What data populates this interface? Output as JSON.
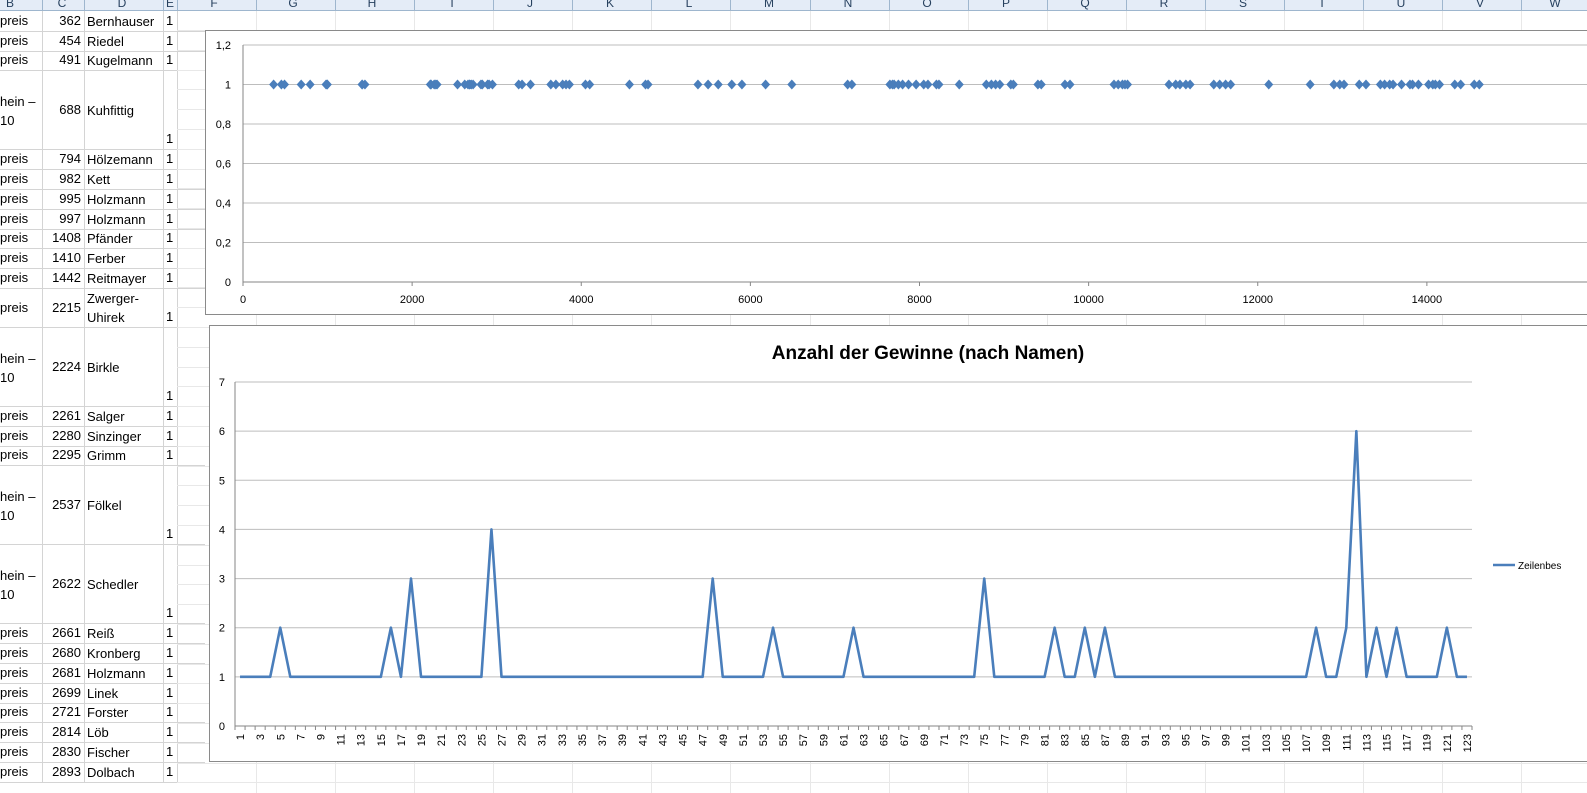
{
  "spreadsheet": {
    "columns": [
      "B",
      "C",
      "D",
      "E",
      "F",
      "G",
      "H",
      "I",
      "J",
      "K",
      "L",
      "M",
      "N",
      "O",
      "P",
      "Q",
      "R",
      "S",
      "T",
      "U",
      "V",
      "W"
    ],
    "rows": [
      {
        "a": "preis",
        "c": "362",
        "d": "Bernhauser",
        "e": "1"
      },
      {
        "a": "preis",
        "c": "454",
        "d": "Riedel",
        "e": "1"
      },
      {
        "a": "preis",
        "c": "491",
        "d": "Kugelmann",
        "e": "1"
      },
      {
        "a": "hein –\n10",
        "c": "688",
        "d": "Kuhfittig",
        "e": "1"
      },
      {
        "a": "preis",
        "c": "794",
        "d": "Hölzemann",
        "e": "1"
      },
      {
        "a": "preis",
        "c": "982",
        "d": "Kett",
        "e": "1"
      },
      {
        "a": "preis",
        "c": "995",
        "d": "Holzmann",
        "e": "1"
      },
      {
        "a": "preis",
        "c": "997",
        "d": "Holzmann",
        "e": "1"
      },
      {
        "a": "preis",
        "c": "1408",
        "d": "Pfänder",
        "e": "1"
      },
      {
        "a": "preis",
        "c": "1410",
        "d": "Ferber",
        "e": "1"
      },
      {
        "a": "preis",
        "c": "1442",
        "d": "Reitmayer",
        "e": "1"
      },
      {
        "a": "preis",
        "c": "2215",
        "d": "Zwerger-\nUhirek",
        "e": "1"
      },
      {
        "a": "hein –\n10",
        "c": "2224",
        "d": "Birkle",
        "e": "1"
      },
      {
        "a": "preis",
        "c": "2261",
        "d": "Salger",
        "e": "1"
      },
      {
        "a": "preis",
        "c": "2280",
        "d": "Sinzinger",
        "e": "1"
      },
      {
        "a": "preis",
        "c": "2295",
        "d": "Grimm",
        "e": "1"
      },
      {
        "a": "hein –\n10",
        "c": "2537",
        "d": "Fölkel",
        "e": "1"
      },
      {
        "a": "hein –\n10",
        "c": "2622",
        "d": "Schedler",
        "e": "1"
      },
      {
        "a": "preis",
        "c": "2661",
        "d": "Reiß",
        "e": "1"
      },
      {
        "a": "preis",
        "c": "2680",
        "d": "Kronberg",
        "e": "1"
      },
      {
        "a": "preis",
        "c": "2681",
        "d": "Holzmann",
        "e": "1"
      },
      {
        "a": "preis",
        "c": "2699",
        "d": "Linek",
        "e": "1"
      },
      {
        "a": "preis",
        "c": "2721",
        "d": "Forster",
        "e": "1"
      },
      {
        "a": "preis",
        "c": "2814",
        "d": "Löb",
        "e": "1"
      },
      {
        "a": "preis",
        "c": "2830",
        "d": "Fischer",
        "e": "1"
      },
      {
        "a": "preis",
        "c": "2893",
        "d": "Dolbach",
        "e": "1"
      }
    ]
  },
  "chart_data": [
    {
      "type": "scatter",
      "title": "",
      "xlim": [
        0,
        16000
      ],
      "ylim": [
        0,
        1.2
      ],
      "xticks": [
        "0",
        "2000",
        "4000",
        "6000",
        "8000",
        "10000",
        "12000",
        "14000"
      ],
      "yticks": [
        "0",
        "0,2",
        "0,4",
        "0,6",
        "0,8",
        "1",
        "1,2"
      ],
      "grid": true,
      "color": "#4a7ebb",
      "x": [
        362,
        454,
        491,
        688,
        794,
        982,
        995,
        997,
        1408,
        1410,
        1442,
        2215,
        2224,
        2261,
        2280,
        2295,
        2537,
        2622,
        2661,
        2680,
        2681,
        2699,
        2721,
        2814,
        2830,
        2893,
        2910,
        2950,
        3260,
        3300,
        3400,
        3640,
        3700,
        3780,
        3820,
        3860,
        4050,
        4100,
        4570,
        4760,
        4790,
        5380,
        5500,
        5620,
        5780,
        5900,
        6180,
        6490,
        7150,
        7200,
        7650,
        7680,
        7700,
        7750,
        7800,
        7870,
        7960,
        8050,
        8100,
        8200,
        8230,
        8470,
        8790,
        8850,
        8900,
        8950,
        9080,
        9110,
        9400,
        9440,
        9720,
        9780,
        10300,
        10350,
        10400,
        10430,
        10460,
        10950,
        11030,
        11080,
        11150,
        11200,
        11480,
        11550,
        11620,
        11680,
        12130,
        12620,
        12900,
        12970,
        13020,
        13200,
        13280,
        13450,
        13500,
        13560,
        13600,
        13700,
        13800,
        13830,
        13900,
        14020,
        14070,
        14100,
        14150,
        14330,
        14400,
        14560,
        14620
      ],
      "y": [
        1,
        1,
        1,
        1,
        1,
        1,
        1,
        1,
        1,
        1,
        1,
        1,
        1,
        1,
        1,
        1,
        1,
        1,
        1,
        1,
        1,
        1,
        1,
        1,
        1,
        1,
        1,
        1,
        1,
        1,
        1,
        1,
        1,
        1,
        1,
        1,
        1,
        1,
        1,
        1,
        1,
        1,
        1,
        1,
        1,
        1,
        1,
        1,
        1,
        1,
        1,
        1,
        1,
        1,
        1,
        1,
        1,
        1,
        1,
        1,
        1,
        1,
        1,
        1,
        1,
        1,
        1,
        1,
        1,
        1,
        1,
        1,
        1,
        1,
        1,
        1,
        1,
        1,
        1,
        1,
        1,
        1,
        1,
        1,
        1,
        1,
        1,
        1,
        1,
        1,
        1,
        1,
        1,
        1,
        1,
        1,
        1,
        1,
        1,
        1,
        1,
        1,
        1,
        1,
        1,
        1,
        1,
        1,
        1
      ]
    },
    {
      "type": "line",
      "title": "Anzahl der Gewinne (nach Namen)",
      "ylim": [
        0,
        7
      ],
      "yticks": [
        "0",
        "1",
        "2",
        "3",
        "4",
        "5",
        "6",
        "7"
      ],
      "xcount": 123,
      "xlabel_step": 2,
      "grid": true,
      "color": "#4a7ebb",
      "legend_position": "right",
      "series": [
        {
          "name": "Zeilenbes",
          "values": [
            1,
            1,
            1,
            1,
            2,
            1,
            1,
            1,
            1,
            1,
            1,
            1,
            1,
            1,
            1,
            2,
            1,
            3,
            1,
            1,
            1,
            1,
            1,
            1,
            1,
            4,
            1,
            1,
            1,
            1,
            1,
            1,
            1,
            1,
            1,
            1,
            1,
            1,
            1,
            1,
            1,
            1,
            1,
            1,
            1,
            1,
            1,
            3,
            1,
            1,
            1,
            1,
            1,
            2,
            1,
            1,
            1,
            1,
            1,
            1,
            1,
            2,
            1,
            1,
            1,
            1,
            1,
            1,
            1,
            1,
            1,
            1,
            1,
            1,
            3,
            1,
            1,
            1,
            1,
            1,
            1,
            2,
            1,
            1,
            2,
            1,
            2,
            1,
            1,
            1,
            1,
            1,
            1,
            1,
            1,
            1,
            1,
            1,
            1,
            1,
            1,
            1,
            1,
            1,
            1,
            1,
            1,
            2,
            1,
            1,
            2,
            6,
            1,
            2,
            1,
            2,
            1,
            1,
            1,
            1,
            2,
            1,
            1
          ]
        }
      ]
    }
  ]
}
